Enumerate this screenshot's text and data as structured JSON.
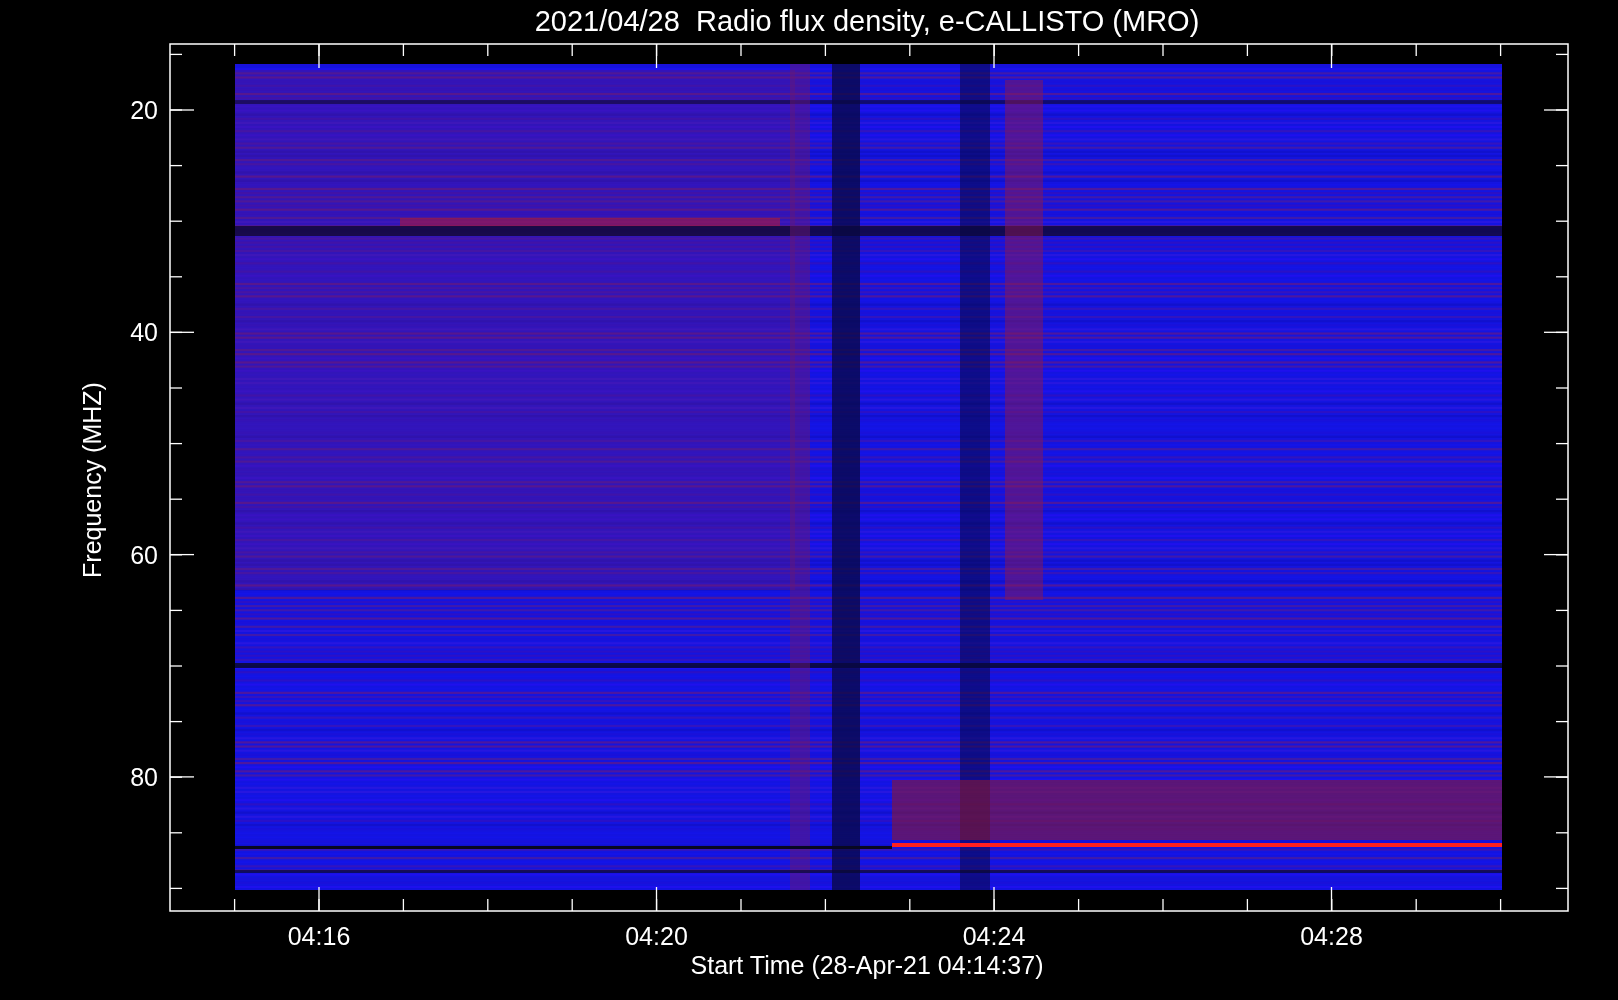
{
  "title": "2021/04/28  Radio flux density, e-CALLISTO (MRO)",
  "y_axis": {
    "label": "Frequency (MHZ)",
    "ticks": [
      "20",
      "40",
      "60",
      "80"
    ]
  },
  "x_axis": {
    "label": "Start Time (28-Apr-21 04:14:37)",
    "ticks": [
      "04:16",
      "04:20",
      "04:24",
      "04:28"
    ]
  }
}
